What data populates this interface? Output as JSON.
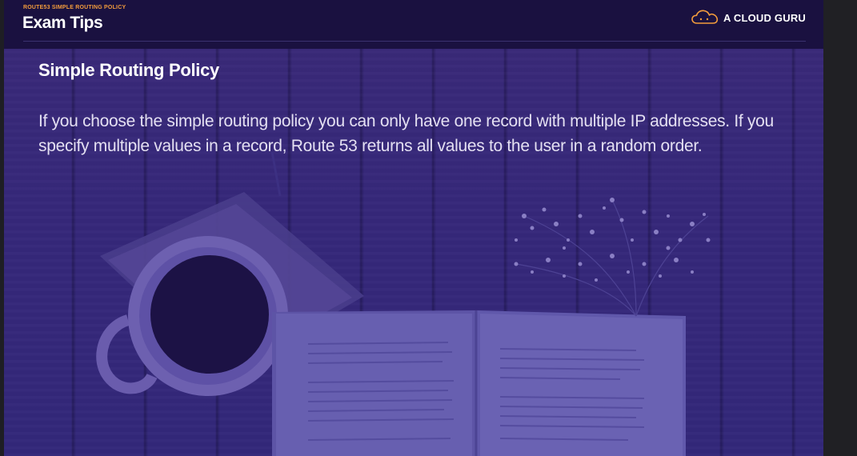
{
  "slide": {
    "kicker": "ROUTE53 SIMPLE ROUTING POLICY",
    "title": "Exam Tips",
    "brand": "A CLOUD GURU",
    "brand_icon": "cloud-logo-icon",
    "heading": "Simple Routing Policy",
    "body": "If you choose the simple routing policy you can only have one record with multiple IP addresses. If you specify multiple values in a record, Route 53 returns all values to the user in a random order."
  },
  "colors": {
    "accent": "#f39c3c",
    "header_bg": "#1a1140",
    "slide_bg": "#36287a",
    "text": "#ffffff"
  }
}
